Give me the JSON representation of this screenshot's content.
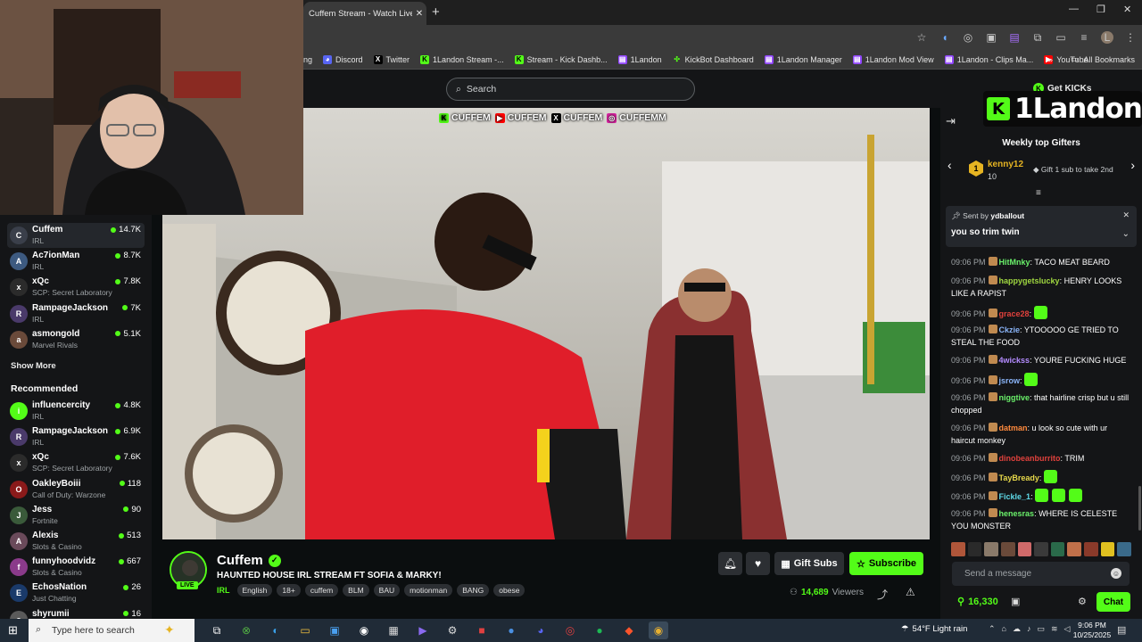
{
  "browser": {
    "tab_title": "Cuffem Stream - Watch Live on",
    "tab_close": "✕",
    "new_tab": "+",
    "window": {
      "minimize": "—",
      "restore": "❐",
      "close": "✕"
    },
    "bookmarks": [
      {
        "label": "ng",
        "icon": "none"
      },
      {
        "label": "Discord",
        "icon": "discord-icon"
      },
      {
        "label": "Twitter",
        "icon": "x-icon"
      },
      {
        "label": "1Landon Stream -...",
        "icon": "kick-icon"
      },
      {
        "label": "Stream - Kick Dashb...",
        "icon": "kick-icon"
      },
      {
        "label": "1Landon",
        "icon": "twitch-icon"
      },
      {
        "label": "KickBot Dashboard",
        "icon": "kickbot-icon"
      },
      {
        "label": "1Landon Manager",
        "icon": "twitch-icon"
      },
      {
        "label": "1Landon Mod View",
        "icon": "twitch-icon"
      },
      {
        "label": "1Landon - Clips Ma...",
        "icon": "twitch-icon"
      },
      {
        "label": "YouTube",
        "icon": "youtube-icon"
      }
    ],
    "more_bookmarks": "»",
    "all_bookmarks": "All Bookmarks",
    "profile_initial": "L"
  },
  "header": {
    "search_placeholder": "Search",
    "get_kicks": "Get KICKs"
  },
  "sidebar": {
    "following": [
      {
        "name": "Cuffem",
        "category": "IRL",
        "viewers": "14.7K",
        "active": true
      },
      {
        "name": "Ac7ionMan",
        "category": "IRL",
        "viewers": "8.7K"
      },
      {
        "name": "xQc",
        "category": "SCP: Secret Laboratory",
        "viewers": "7.8K"
      },
      {
        "name": "RampageJackson",
        "category": "IRL",
        "viewers": "7K"
      },
      {
        "name": "asmongold",
        "category": "Marvel Rivals",
        "viewers": "5.1K"
      }
    ],
    "show_more": "Show More",
    "recommended_title": "Recommended",
    "recommended": [
      {
        "name": "influencercity",
        "category": "IRL",
        "viewers": "4.8K"
      },
      {
        "name": "RampageJackson",
        "category": "IRL",
        "viewers": "6.9K"
      },
      {
        "name": "xQc",
        "category": "SCP: Secret Laboratory",
        "viewers": "7.6K"
      },
      {
        "name": "OakleyBoiii",
        "category": "Call of Duty: Warzone",
        "viewers": "118"
      },
      {
        "name": "Jess",
        "category": "Fortnite",
        "viewers": "90"
      },
      {
        "name": "Alexis",
        "category": "Slots & Casino",
        "viewers": "513"
      },
      {
        "name": "funnyhoodvidz",
        "category": "Slots & Casino",
        "viewers": "667"
      },
      {
        "name": "EchosNation",
        "category": "Just Chatting",
        "viewers": "26"
      },
      {
        "name": "shyrumii",
        "category": "",
        "viewers": "16"
      }
    ]
  },
  "video": {
    "banner": [
      "CUFFEM",
      "CUFFEM",
      "CUFFEM",
      "CUFFEMM"
    ]
  },
  "stream": {
    "name": "Cuffem",
    "live": "LIVE",
    "title": "HAUNTED HOUSE IRL STREAM FT SOFIA & MARKY!",
    "category": "IRL",
    "tags": [
      "English",
      "18+",
      "cuffem",
      "BLM",
      "BAU",
      "motionman",
      "BANG",
      "obese"
    ],
    "gift_label": "Gift Subs",
    "subscribe_label": "Subscribe",
    "viewers": "14,689",
    "viewers_label": "Viewers"
  },
  "chat": {
    "brand": "1Landon",
    "weekly_title": "Weekly top Gifters",
    "top_gifter": {
      "rank": "1",
      "name": "kenny12",
      "count": "10"
    },
    "gift_cta": "Gift 1 sub to take 2nd",
    "pinned": {
      "sent_by": "Sent by",
      "by_user": "ydballout",
      "message": "you so trim twin"
    },
    "messages": [
      {
        "time": "09:06 PM",
        "user": "HitMnky",
        "color": "#6af06a",
        "text": ": TACO MEAT BEARD"
      },
      {
        "time": "09:06 PM",
        "user": "happygetslucky",
        "color": "#9fd640",
        "text": ": HENRY LOOKS LIKE A RAPIST"
      },
      {
        "time": "09:06 PM",
        "user": "grace28",
        "color": "#e0413c",
        "text": ":"
      },
      {
        "time": "09:06 PM",
        "user": "Ckzie",
        "color": "#8ab4f8",
        "text": ": YTOOOOO GE TRIED TO STEAL THE FOOD"
      },
      {
        "time": "09:06 PM",
        "user": "4wickss",
        "color": "#b48cff",
        "text": ": YOURE FUCKING HUGE"
      },
      {
        "time": "09:06 PM",
        "user": "jsrow",
        "color": "#8ab4f8",
        "text": ":"
      },
      {
        "time": "09:06 PM",
        "user": "niggtive",
        "color": "#6af06a",
        "text": ": that hairline crisp but u still chopped"
      },
      {
        "time": "09:06 PM",
        "user": "datman",
        "color": "#ff8a3d",
        "text": ": u look so cute with ur haircut monkey"
      },
      {
        "time": "09:06 PM",
        "user": "dinobeanburrito",
        "color": "#e0413c",
        "text": ": TRIM"
      },
      {
        "time": "09:06 PM",
        "user": "TayBready",
        "color": "#e6d84a",
        "text": ":"
      },
      {
        "time": "09:06 PM",
        "user": "Fickle_1",
        "color": "#5ed8e6",
        "text": ":"
      },
      {
        "time": "09:06 PM",
        "user": "henesras",
        "color": "#6af06a",
        "text": ": WHERE IS CELESTE YOU MONSTER"
      }
    ],
    "send_placeholder": "Send a message",
    "points": "16,330",
    "chat_button": "Chat"
  },
  "taskbar": {
    "search_placeholder": "Type here to search",
    "weather": "54°F  Light rain",
    "time": "9:06 PM",
    "date": "10/25/2025"
  }
}
